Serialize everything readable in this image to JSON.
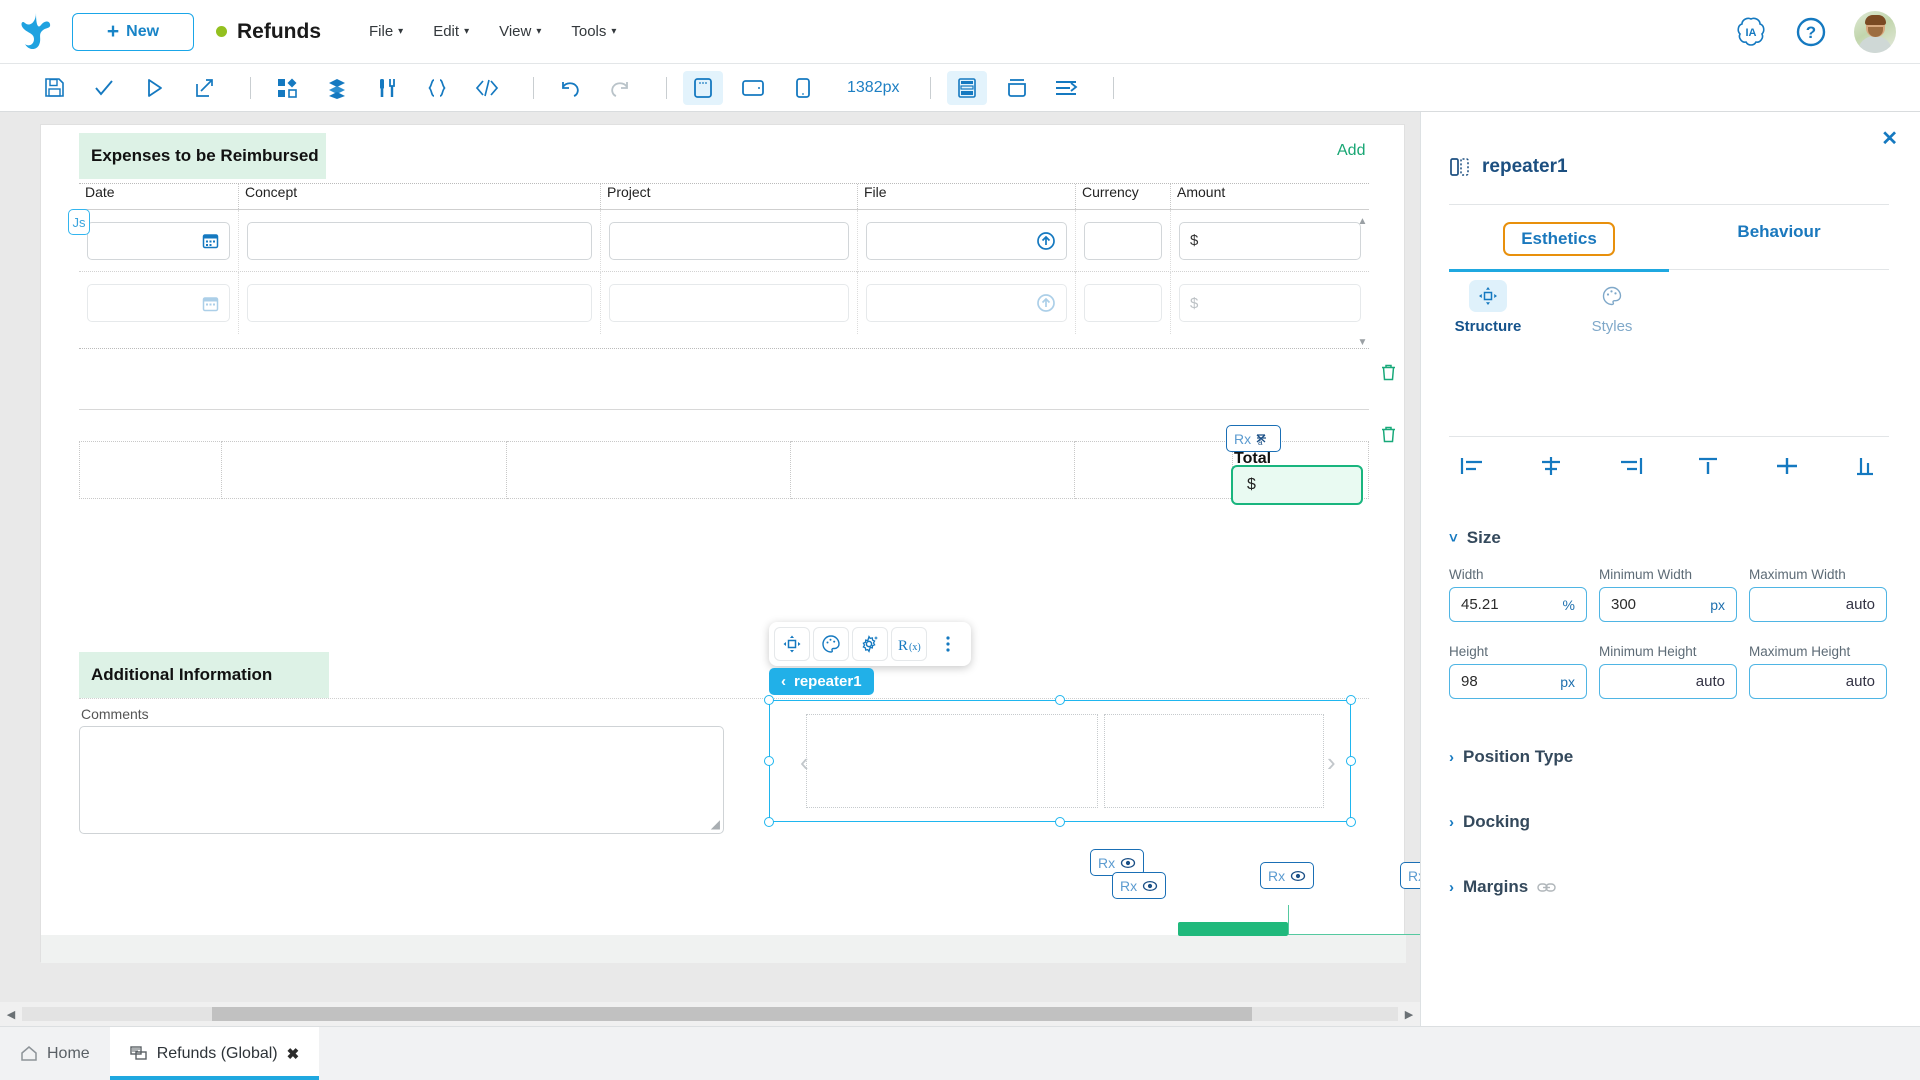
{
  "topbar": {
    "new_button": "New",
    "document_title": "Refunds",
    "menus": [
      "File",
      "Edit",
      "View",
      "Tools"
    ],
    "icons": {
      "ia": "IA",
      "help": "?"
    }
  },
  "toolbar": {
    "viewport_size": "1382px",
    "items": [
      {
        "name": "save-icon",
        "label": "Save"
      },
      {
        "name": "check-icon",
        "label": "Validate"
      },
      {
        "name": "play-icon",
        "label": "Run"
      },
      {
        "name": "share-icon",
        "label": "Deploy"
      },
      {
        "name": "components-icon",
        "label": "Components"
      },
      {
        "name": "layers-icon",
        "label": "Layers"
      },
      {
        "name": "tools-icon",
        "label": "Tools"
      },
      {
        "name": "braces-icon",
        "label": "Variables"
      },
      {
        "name": "code-icon",
        "label": "Code"
      },
      {
        "name": "undo-icon",
        "label": "Undo"
      },
      {
        "name": "redo-icon",
        "label": "Redo"
      },
      {
        "name": "desktop-view-icon",
        "label": "Desktop"
      },
      {
        "name": "tablet-view-icon",
        "label": "Tablet"
      },
      {
        "name": "mobile-view-icon",
        "label": "Mobile"
      },
      {
        "name": "grid-layout-icon",
        "label": "Grid"
      },
      {
        "name": "container-icon",
        "label": "Container"
      },
      {
        "name": "align-distribute-icon",
        "label": "Align"
      }
    ]
  },
  "canvas": {
    "section1": {
      "title": "Expenses to be Reimbursed",
      "add_label": "Add",
      "columns": [
        "Date",
        "Concept",
        "Project",
        "File",
        "Currency",
        "Amount"
      ],
      "rows": [
        {
          "date": "",
          "concept": "",
          "project": "",
          "file": "",
          "currency": "",
          "amount": "$",
          "state": "active"
        },
        {
          "date": "",
          "concept": "",
          "project": "",
          "file": "",
          "currency": "",
          "amount": "$",
          "state": "ghost"
        }
      ],
      "js_badge": "Js"
    },
    "total": {
      "label": "Total",
      "value": "$",
      "rx_badge": "Rx"
    },
    "section2": {
      "title": "Additional Information",
      "comments_label": "Comments",
      "comments_value": ""
    },
    "selected_element": {
      "tag": "repeater1",
      "back_chevron": "‹"
    },
    "float_toolbar": [
      {
        "name": "structure-icon",
        "label": "Structure"
      },
      {
        "name": "styles-palette-icon",
        "label": "Styles"
      },
      {
        "name": "settings-icon",
        "label": "Settings"
      },
      {
        "name": "rx-function-icon",
        "label": "R(x)"
      },
      {
        "name": "more-options-icon",
        "label": "More"
      }
    ],
    "rx_badges": [
      "Rx",
      "Rx",
      "Rx",
      "Rx"
    ]
  },
  "right_panel": {
    "element_name": "repeater1",
    "close": "✕",
    "tabs": [
      {
        "label": "Esthetics",
        "selected": true
      },
      {
        "label": "Behaviour",
        "selected": false
      }
    ],
    "subtabs": [
      {
        "label": "Structure",
        "active": true
      },
      {
        "label": "Styles",
        "active": false
      }
    ],
    "align_buttons": [
      "align-left-icon",
      "align-center-horizontal-icon",
      "align-right-icon",
      "align-top-icon",
      "align-center-vertical-icon",
      "align-bottom-icon"
    ],
    "sections": {
      "size": {
        "title": "Size",
        "expanded": true,
        "fields": [
          {
            "label": "Width",
            "value": "45.21",
            "unit": "%"
          },
          {
            "label": "Minimum Width",
            "value": "300",
            "unit": "px"
          },
          {
            "label": "Maximum Width",
            "value": "auto",
            "unit": ""
          },
          {
            "label": "Height",
            "value": "98",
            "unit": "px"
          },
          {
            "label": "Minimum Height",
            "value": "auto",
            "unit": ""
          },
          {
            "label": "Maximum Height",
            "value": "auto",
            "unit": ""
          }
        ]
      },
      "position_type": {
        "title": "Position Type",
        "expanded": false
      },
      "docking": {
        "title": "Docking",
        "expanded": false
      },
      "margins": {
        "title": "Margins",
        "expanded": false,
        "linked_icon": "link-icon"
      }
    }
  },
  "bottom_tabs": [
    {
      "label": "Home",
      "icon": "home-icon",
      "active": false,
      "closable": false
    },
    {
      "label": "Refunds (Global)",
      "icon": "form-icon",
      "active": true,
      "closable": true,
      "close": "✖"
    }
  ],
  "colors": {
    "accent_blue": "#1fa8e0",
    "link_blue": "#1579c0",
    "green_header": "#ddf2e6",
    "green_accent": "#19b57e",
    "orange_highlight": "#e8900c"
  }
}
